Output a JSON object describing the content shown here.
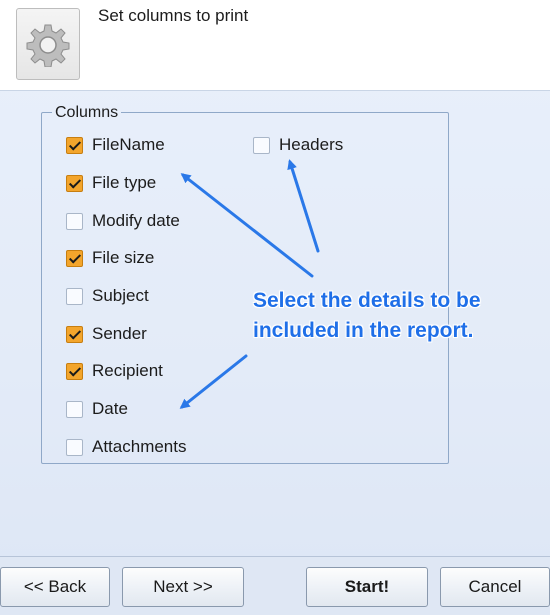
{
  "header": {
    "title": "Set columns to print",
    "icon": "gear-icon"
  },
  "columns_group": {
    "legend": "Columns",
    "items": [
      {
        "label": "FileName",
        "checked": true
      },
      {
        "label": "File type",
        "checked": true
      },
      {
        "label": "Modify date",
        "checked": false
      },
      {
        "label": "File size",
        "checked": true
      },
      {
        "label": "Subject",
        "checked": false
      },
      {
        "label": "Sender",
        "checked": true
      },
      {
        "label": "Recipient",
        "checked": true
      },
      {
        "label": "Date",
        "checked": false
      },
      {
        "label": "Attachments",
        "checked": false
      },
      {
        "label": "Headers",
        "checked": false
      }
    ]
  },
  "annotation": {
    "line1": "Select the details to be",
    "line2": "included in the report.",
    "color": "#1f6fe8"
  },
  "buttons": {
    "back": "<< Back",
    "next": "Next >>",
    "start": "Start!",
    "cancel": "Cancel"
  }
}
